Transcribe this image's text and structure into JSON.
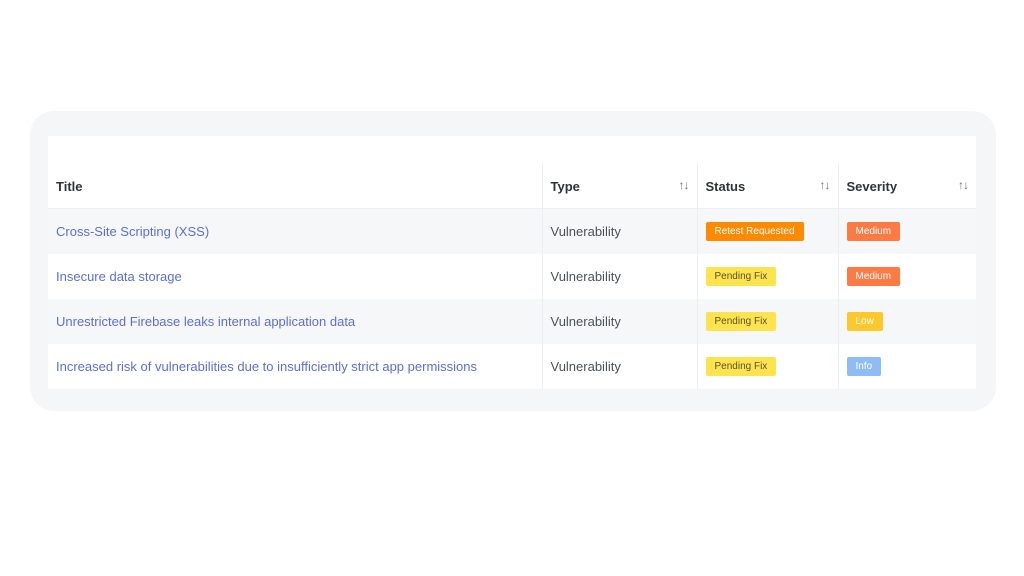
{
  "table": {
    "columns": [
      {
        "label": "Title",
        "sortable": false
      },
      {
        "label": "Type",
        "sortable": true
      },
      {
        "label": "Status",
        "sortable": true
      },
      {
        "label": "Severity",
        "sortable": true
      }
    ],
    "sort_icon": "↑↓",
    "rows": [
      {
        "title": "Cross-Site Scripting (XSS)",
        "type": "Vulnerability",
        "status": "Retest Requested",
        "severity": "Medium"
      },
      {
        "title": "Insecure data storage",
        "type": "Vulnerability",
        "status": "Pending Fix",
        "severity": "Medium"
      },
      {
        "title": "Unrestricted Firebase leaks internal application data",
        "type": "Vulnerability",
        "status": "Pending Fix",
        "severity": "Low"
      },
      {
        "title": "Increased risk of vulnerabilities due to insufficiently strict app permissions",
        "type": "Vulnerability",
        "status": "Pending Fix",
        "severity": "Info"
      }
    ]
  },
  "colors": {
    "retest_requested": "#fd8a00",
    "pending_fix": "#fde44f",
    "medium": "#fd7a45",
    "low": "#fdc82b",
    "info": "#8ebdf5",
    "link": "#5b6fd6"
  }
}
